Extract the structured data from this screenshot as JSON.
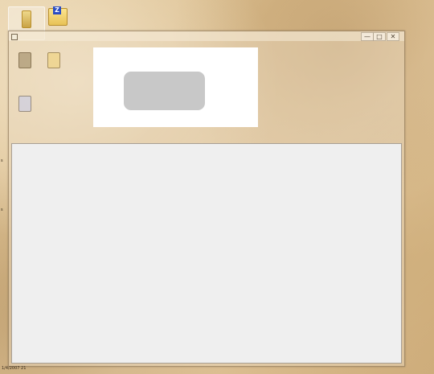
{
  "desktop": {
    "icons": [
      {
        "label": "",
        "icon": "folder-icon"
      },
      {
        "label": "",
        "icon": "archive-icon",
        "badge": "Z"
      }
    ],
    "bottom_text": "1/4/2007 21"
  },
  "window": {
    "title": "",
    "minimize_glyph": "—",
    "maximize_glyph": "□",
    "close_glyph": "✕",
    "inner_icons": [
      {
        "label": "",
        "icon": "file-icon"
      },
      {
        "label": "",
        "icon": "folder-icon"
      },
      {
        "label": "",
        "icon": "document-icon"
      }
    ]
  },
  "colors": {
    "content_panel": "#efefef",
    "white_panel": "#ffffff",
    "grey_button": "#c8c8c8"
  }
}
